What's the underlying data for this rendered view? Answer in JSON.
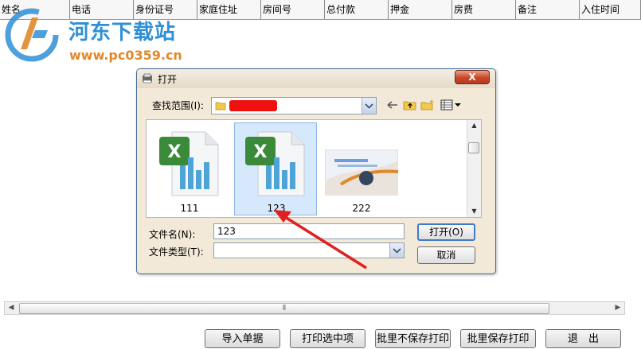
{
  "grid": {
    "columns": [
      "姓名",
      "电话",
      "身份证号",
      "家庭住址",
      "房间号",
      "总付款",
      "押金",
      "房费",
      "备注",
      "入住时间"
    ]
  },
  "watermark": {
    "brand": "河东下载站",
    "url": "www.pc0359.cn"
  },
  "bottom_buttons": {
    "import": "导入单据",
    "print_selected": "打印选中项",
    "batch_print_nosave": "批里不保存打印",
    "batch_print_save": "批里保存打印",
    "exit": "退　出"
  },
  "dialog": {
    "title": "打开",
    "close_symbol": "X",
    "look_in_label": "查找范围(I):",
    "files": [
      {
        "name": "111",
        "type": "excel",
        "selected": false
      },
      {
        "name": "123",
        "type": "excel",
        "selected": true
      },
      {
        "name": "222",
        "type": "image",
        "selected": false
      }
    ],
    "filename_label": "文件名(N):",
    "filename_value": "123",
    "filetype_label": "文件类型(T):",
    "filetype_value": "",
    "open_button": "打开(O)",
    "cancel_button": "取消"
  },
  "colors": {
    "accent_blue": "#2e8fd6",
    "watermark_orange": "#e0882a",
    "close_red": "#c8462a",
    "selection_blue": "#d6e8fb",
    "arrow_red": "#e02020"
  },
  "icons": [
    "back-arrow-icon",
    "up-folder-icon",
    "new-folder-icon",
    "view-menu-icon",
    "folder-icon",
    "excel-file-icon",
    "image-thumbnail-icon"
  ]
}
